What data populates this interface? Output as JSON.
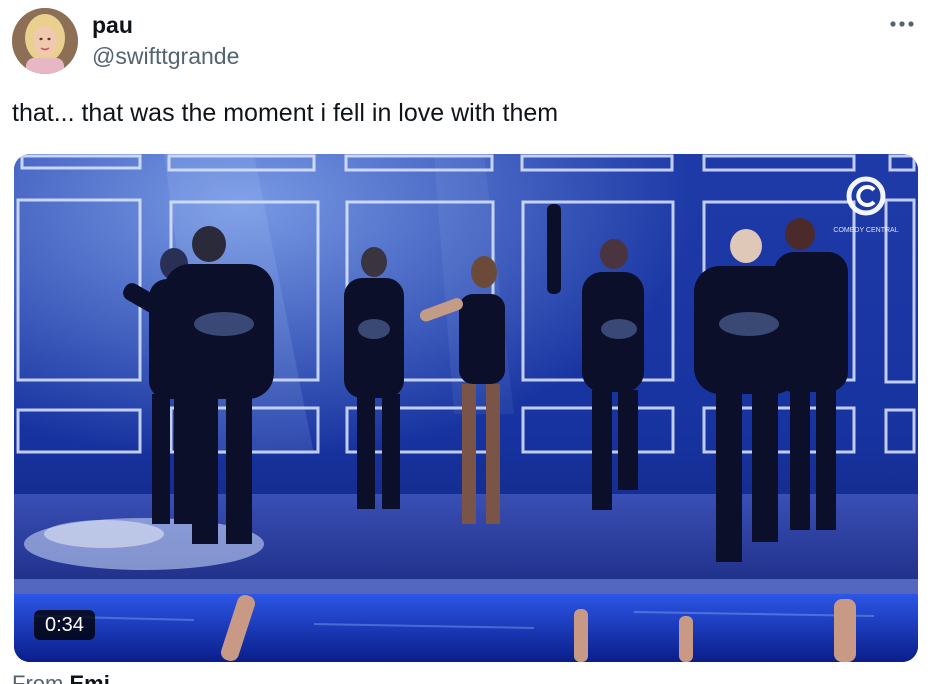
{
  "author": {
    "name": "pau",
    "handle": "@swifttgrande",
    "avatar_icon": "user-avatar-photo"
  },
  "menu": {
    "more_icon": "more-horizontal-icon"
  },
  "tweet": {
    "text": "that... that was the moment i fell in love with them"
  },
  "media": {
    "type": "video",
    "duration": "0:34",
    "channel_logo_icon": "comedy-central-logo",
    "channel_logo_text": "COMEDY CENTRAL"
  },
  "attribution": {
    "prefix": "From",
    "name": "Emi"
  },
  "colors": {
    "text_primary": "#0f1419",
    "text_secondary": "#536471",
    "stage_blue": "#1b3fd1"
  }
}
